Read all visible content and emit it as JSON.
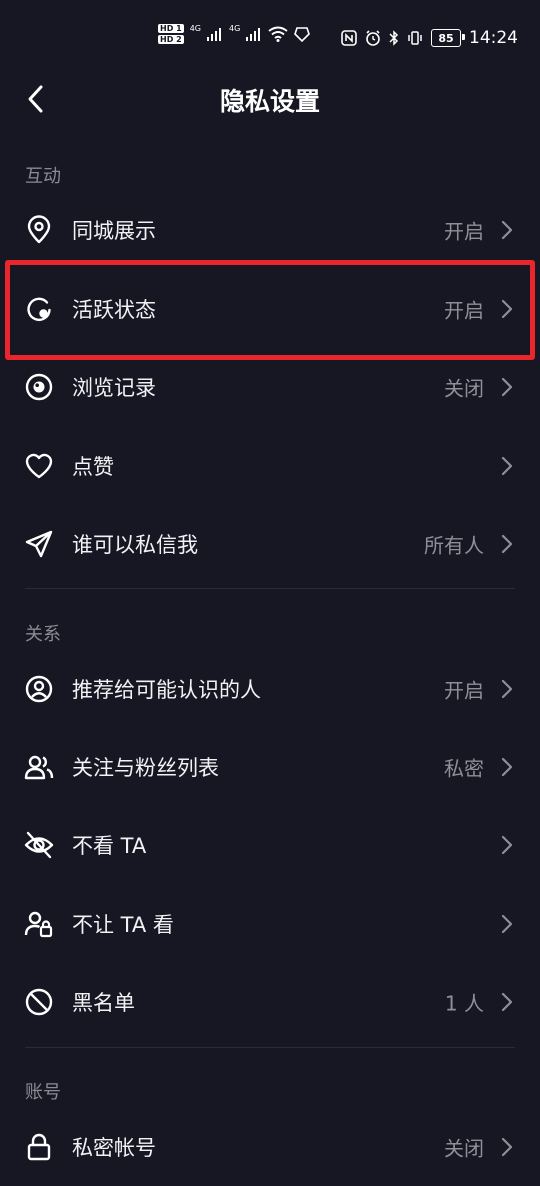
{
  "status_bar": {
    "hd1": "HD 1",
    "hd2": "HD 2",
    "net1": "4G",
    "net2": "4G",
    "battery": "85",
    "time": "14:24"
  },
  "nav": {
    "title": "隐私设置"
  },
  "sections": {
    "interaction": "互动",
    "relationship": "关系",
    "account": "账号"
  },
  "rows": [
    {
      "label": "同城展示",
      "value": "开启",
      "icon": "location-pin-icon"
    },
    {
      "label": "活跃状态",
      "value": "开启",
      "icon": "active-status-icon"
    },
    {
      "label": "浏览记录",
      "value": "关闭",
      "icon": "eye-icon"
    },
    {
      "label": "点赞",
      "value": "",
      "icon": "heart-icon"
    },
    {
      "label": "谁可以私信我",
      "value": "所有人",
      "icon": "send-icon"
    },
    {
      "label": "推荐给可能认识的人",
      "value": "开启",
      "icon": "user-circle-icon"
    },
    {
      "label": "关注与粉丝列表",
      "value": "私密",
      "icon": "users-icon"
    },
    {
      "label": "不看 TA",
      "value": "",
      "icon": "eye-off-icon"
    },
    {
      "label": "不让 TA 看",
      "value": "",
      "icon": "user-lock-icon"
    },
    {
      "label": "黑名单",
      "value": "1 人",
      "icon": "block-icon"
    },
    {
      "label": "私密帐号",
      "value": "关闭",
      "icon": "lock-icon"
    }
  ],
  "colors": {
    "background": "#161722",
    "highlight": "#e8262b",
    "secondary_text": "#8e8f97"
  }
}
